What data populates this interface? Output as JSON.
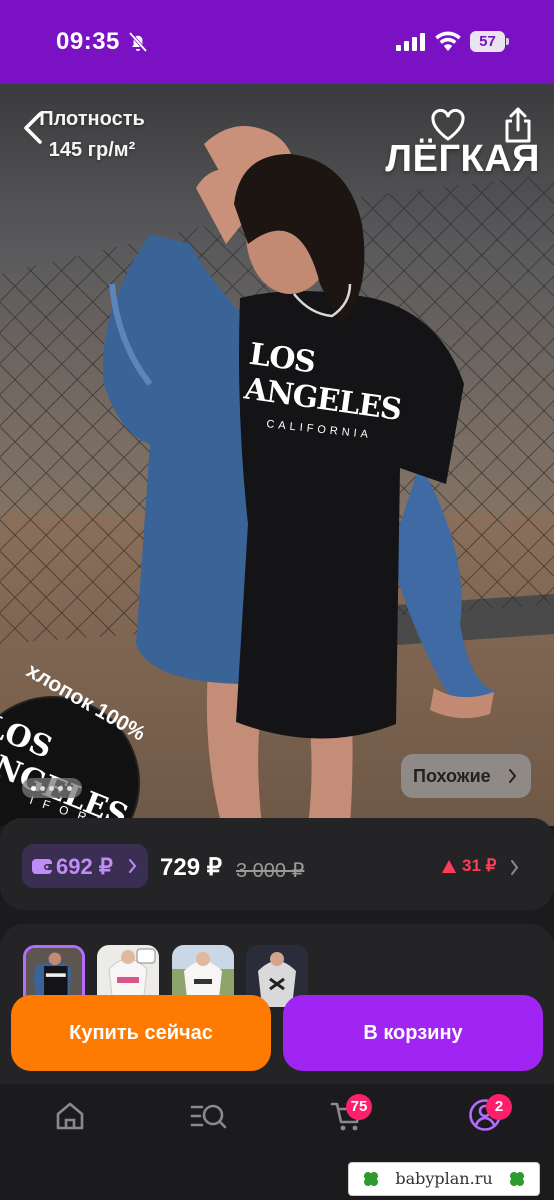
{
  "status_bar": {
    "time": "09:35",
    "battery": "57"
  },
  "hero": {
    "density_label": "Плотность",
    "density_value": "145 гр/м²",
    "weight_title": "ЛЁГКАЯ",
    "shirt_print_main": "LOS ANGELES",
    "shirt_print_sub": "CALIFORNIA",
    "cotton_label": "хлопок 100%",
    "zoom_print_main": "LOS ANGELES",
    "zoom_print_sub": "IFORN",
    "similar_label": "Похожие",
    "pager_count": 5,
    "pager_active": 0
  },
  "price": {
    "wallet_price": "692 ₽",
    "current": "729 ₽",
    "old": "3 000 ₽",
    "change": "31 ₽",
    "accent": "#c08cf5",
    "change_color": "#ff3d5a"
  },
  "variants": {
    "count": 4,
    "selected": 0
  },
  "actions": {
    "buy_now": "Купить сейчас",
    "to_cart": "В корзину",
    "buy_color": "#ff7a00",
    "cart_color": "#a125f2"
  },
  "nav": {
    "items": [
      "home-icon",
      "catalog-search-icon",
      "cart-icon",
      "profile-icon"
    ],
    "cart_badge": "75",
    "profile_badge": "2"
  },
  "watermark": {
    "text": "babyplan.ru"
  }
}
